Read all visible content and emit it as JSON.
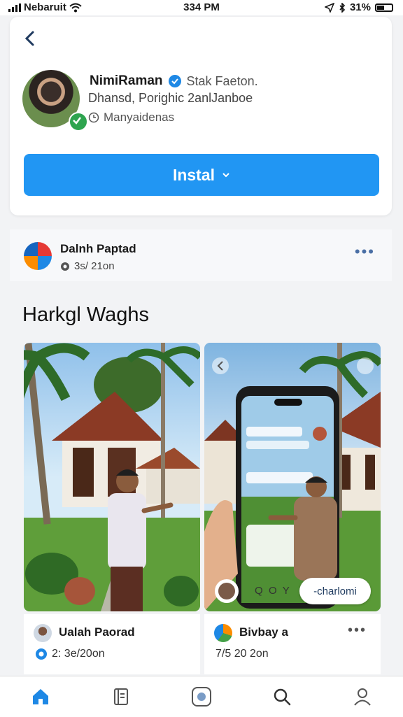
{
  "status_bar": {
    "carrier": "Nebaruit",
    "time": "334 PM",
    "battery": "31%"
  },
  "profile": {
    "name": "NimiRaman",
    "role": "Stak Faeton.",
    "bio": "Dhansd, Porighic 2anlJanboe",
    "location": "Manyaidenas",
    "primary_button": "Instal"
  },
  "post": {
    "title": "Dalnh Paptad",
    "date": "3s/ 21on"
  },
  "section_title": "Harkgl Waghs",
  "cards": [
    {
      "name": "Ualah Paorad",
      "date": "2: 3e/20on"
    },
    {
      "name": "Bivbay a",
      "date": "7/5 20 2on"
    }
  ],
  "phone_overlay": {
    "pill_text": "-charlomi",
    "letters": "Q  O  Y"
  },
  "colors": {
    "accent": "#2196f3",
    "verified": "#1e88e5",
    "online": "#2ea44f"
  },
  "tab_bar": [
    "home-icon",
    "book-icon",
    "apps-icon",
    "search-icon",
    "profile-icon"
  ]
}
